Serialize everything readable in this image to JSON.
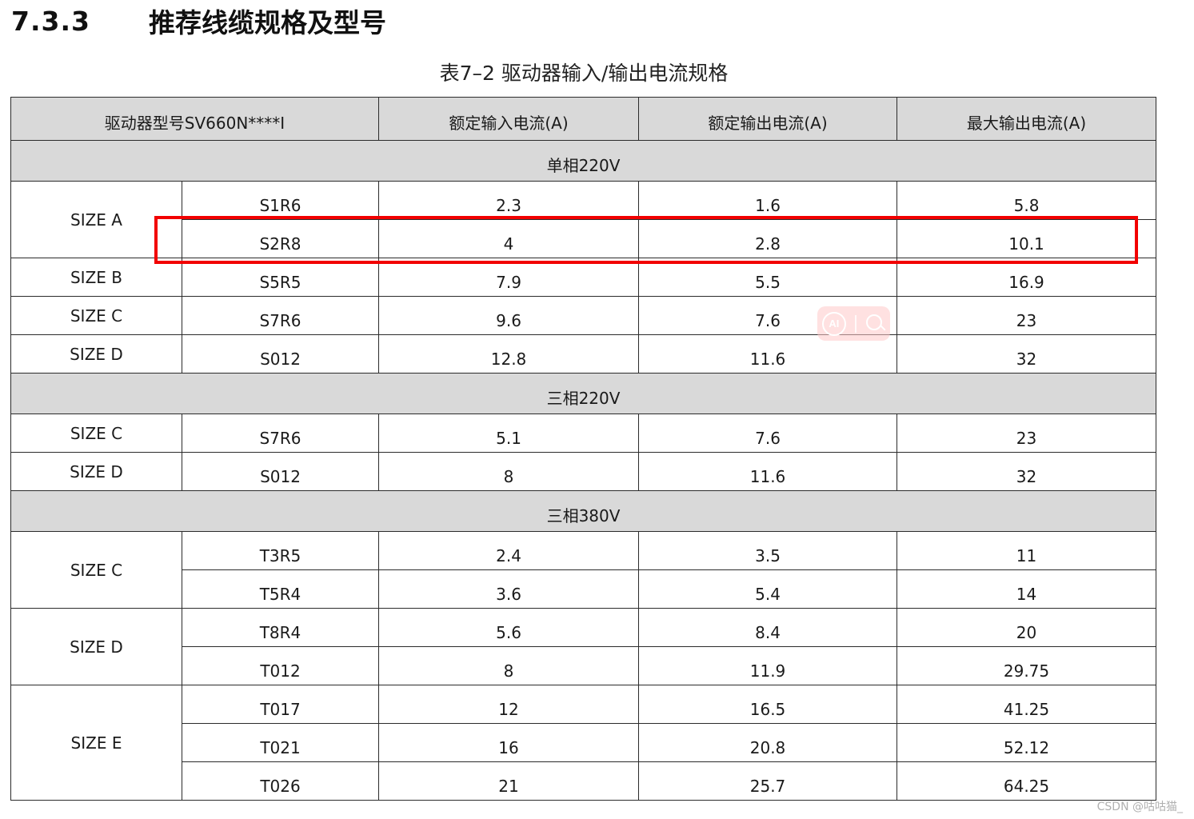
{
  "section": {
    "number": "7.3.3",
    "title": "推荐线缆规格及型号"
  },
  "caption": "表7–2 驱动器输入/输出电流规格",
  "table": {
    "headers": [
      "驱动器型号SV660N****I",
      "额定输入电流(A)",
      "额定输出电流(A)",
      "最大输出电流(A)"
    ],
    "groups": [
      {
        "label": "单相220V",
        "sizes": [
          {
            "size": "SIZE A",
            "rows": [
              {
                "model": "S1R6",
                "in": "2.3",
                "out": "1.6",
                "max": "5.8"
              },
              {
                "model": "S2R8",
                "in": "4",
                "out": "2.8",
                "max": "10.1"
              }
            ]
          },
          {
            "size": "SIZE B",
            "rows": [
              {
                "model": "S5R5",
                "in": "7.9",
                "out": "5.5",
                "max": "16.9"
              }
            ]
          },
          {
            "size": "SIZE C",
            "rows": [
              {
                "model": "S7R6",
                "in": "9.6",
                "out": "7.6",
                "max": "23"
              }
            ]
          },
          {
            "size": "SIZE D",
            "rows": [
              {
                "model": "S012",
                "in": "12.8",
                "out": "11.6",
                "max": "32"
              }
            ]
          }
        ]
      },
      {
        "label": "三相220V",
        "sizes": [
          {
            "size": "SIZE C",
            "rows": [
              {
                "model": "S7R6",
                "in": "5.1",
                "out": "7.6",
                "max": "23"
              }
            ]
          },
          {
            "size": "SIZE D",
            "rows": [
              {
                "model": "S012",
                "in": "8",
                "out": "11.6",
                "max": "32"
              }
            ]
          }
        ]
      },
      {
        "label": "三相380V",
        "sizes": [
          {
            "size": "SIZE C",
            "rows": [
              {
                "model": "T3R5",
                "in": "2.4",
                "out": "3.5",
                "max": "11"
              },
              {
                "model": "T5R4",
                "in": "3.6",
                "out": "5.4",
                "max": "14"
              }
            ]
          },
          {
            "size": "SIZE D",
            "rows": [
              {
                "model": "T8R4",
                "in": "5.6",
                "out": "8.4",
                "max": "20"
              },
              {
                "model": "T012",
                "in": "8",
                "out": "11.9",
                "max": "29.75"
              }
            ]
          },
          {
            "size": "SIZE E",
            "rows": [
              {
                "model": "T017",
                "in": "12",
                "out": "16.5",
                "max": "41.25"
              },
              {
                "model": "T021",
                "in": "16",
                "out": "20.8",
                "max": "52.12"
              },
              {
                "model": "T026",
                "in": "21",
                "out": "25.7",
                "max": "64.25"
              }
            ]
          }
        ]
      }
    ]
  },
  "annotations": {
    "highlight_color": "#f20000",
    "highlighted_model": "S2R8"
  },
  "ai_widget": {
    "label": "AI",
    "icons": [
      "ai-icon",
      "search-icon"
    ]
  },
  "watermark": "CSDN @咕咕猫_"
}
